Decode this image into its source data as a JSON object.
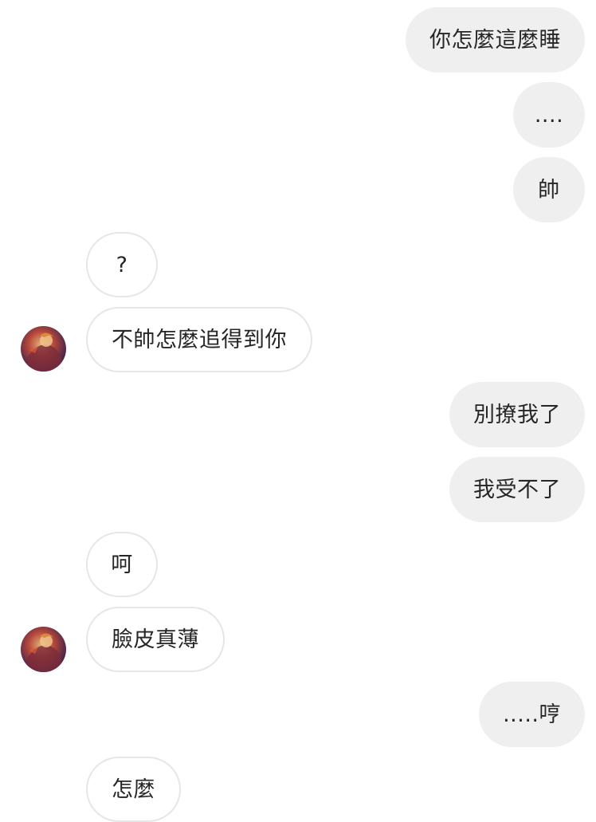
{
  "conversation": {
    "messages": [
      {
        "side": "sent",
        "text": "你怎麼這麼睡"
      },
      {
        "side": "sent",
        "text": "...."
      },
      {
        "side": "sent",
        "text": "帥"
      },
      {
        "side": "received",
        "text": "?"
      },
      {
        "side": "received",
        "text": "不帥怎麼追得到你"
      },
      {
        "side": "sent",
        "text": "別撩我了"
      },
      {
        "side": "sent",
        "text": "我受不了"
      },
      {
        "side": "received",
        "text": "呵"
      },
      {
        "side": "received",
        "text": "臉皮真薄"
      },
      {
        "side": "sent",
        "text": ".....哼"
      },
      {
        "side": "received",
        "text": "怎麼"
      }
    ]
  },
  "colors": {
    "sent_bubble": "#efefef",
    "received_border": "#e6e6e6",
    "text": "#262626"
  },
  "icons": {
    "avatar": "contact-avatar-illustration"
  }
}
